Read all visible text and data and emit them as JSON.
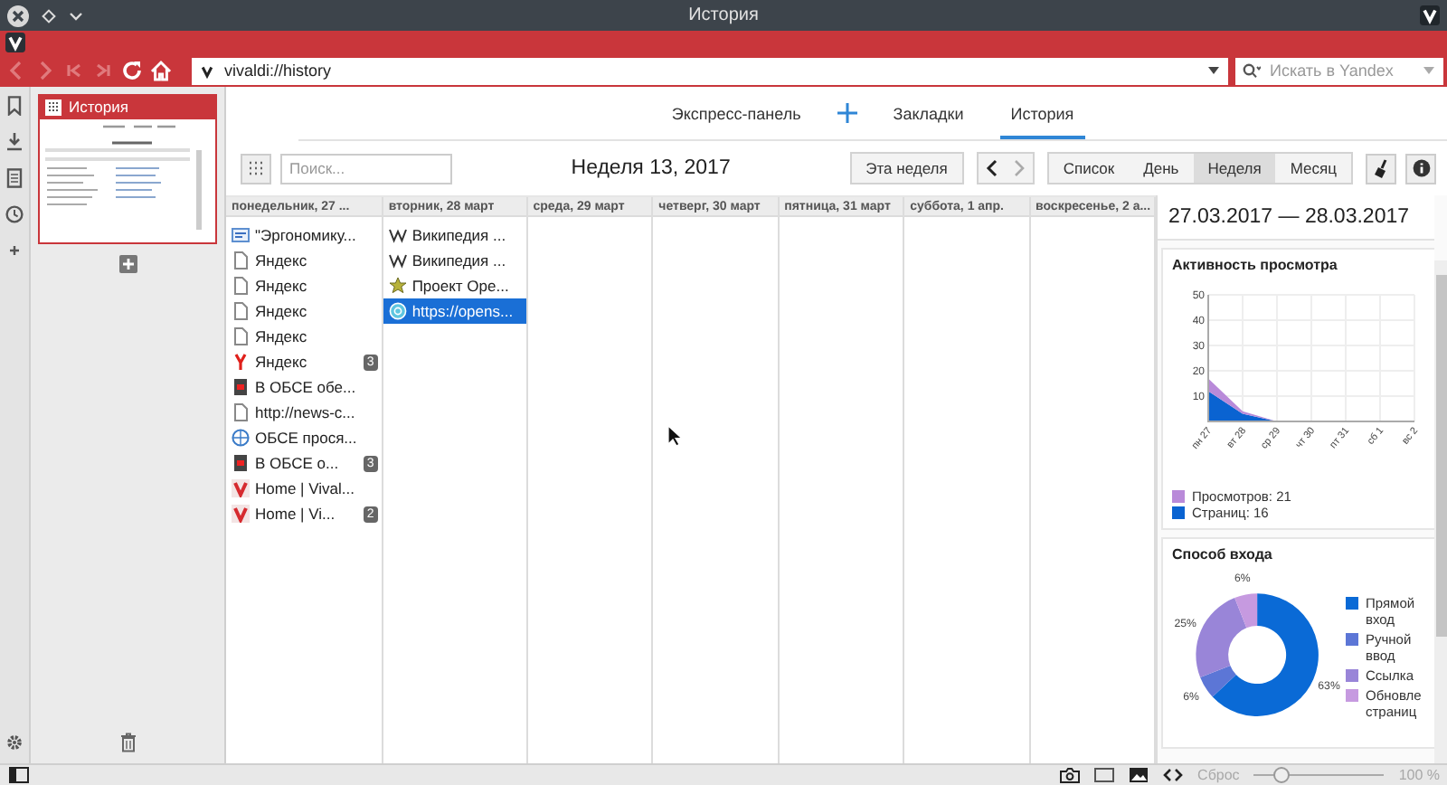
{
  "window": {
    "title": "История"
  },
  "address_bar": {
    "url": "vivaldi://history",
    "search_placeholder": "Искать в Yandex"
  },
  "panel": {
    "tab_title": "История"
  },
  "nav_tabs": [
    {
      "label": "Экспресс-панель",
      "selected": false
    },
    {
      "label": "Закладки",
      "selected": false
    },
    {
      "label": "История",
      "selected": true
    }
  ],
  "toolbar": {
    "search_placeholder": "Поиск...",
    "title": "Неделя 13, 2017",
    "this_week": "Эта неделя",
    "views": [
      {
        "label": "Список",
        "selected": false
      },
      {
        "label": "День",
        "selected": false
      },
      {
        "label": "Неделя",
        "selected": true
      },
      {
        "label": "Месяц",
        "selected": false
      }
    ]
  },
  "days": [
    {
      "header": "понедельник, 27 ...",
      "entries": [
        {
          "title": "\"Эргономику...",
          "kind": "rss",
          "selected": false
        },
        {
          "title": "Яндекс",
          "kind": "page",
          "selected": false
        },
        {
          "title": "Яндекс",
          "kind": "page",
          "selected": false
        },
        {
          "title": "Яндекс",
          "kind": "page",
          "selected": false
        },
        {
          "title": "Яндекс",
          "kind": "page",
          "selected": false
        },
        {
          "title": "Яндекс",
          "kind": "yandex",
          "count": "3",
          "selected": false
        },
        {
          "title": "В ОБСЕ обе...",
          "kind": "news",
          "selected": false
        },
        {
          "title": "http://news-c...",
          "kind": "page",
          "selected": false
        },
        {
          "title": "ОБСЕ прося...",
          "kind": "globe",
          "selected": false
        },
        {
          "title": "В ОБСЕ о...",
          "kind": "news",
          "count": "3",
          "selected": false
        },
        {
          "title": "Home | Vival...",
          "kind": "vivaldi",
          "selected": false
        },
        {
          "title": "Home | Vi...",
          "kind": "vivaldi",
          "count": "2",
          "selected": false
        }
      ]
    },
    {
      "header": "вторник, 28 март",
      "entries": [
        {
          "title": "Википедия ...",
          "kind": "wikipedia",
          "selected": false
        },
        {
          "title": "Википедия ...",
          "kind": "wikipedia",
          "selected": false
        },
        {
          "title": "Проект Ope...",
          "kind": "star",
          "selected": false
        },
        {
          "title": "https://opens...",
          "kind": "web",
          "selected": true
        }
      ]
    },
    {
      "header": "среда, 29 март"
    },
    {
      "header": "четверг, 30 март"
    },
    {
      "header": "пятница, 31 март"
    },
    {
      "header": "суббота, 1 апр."
    },
    {
      "header": "воскресенье, 2 а..."
    }
  ],
  "stats": {
    "range": "27.03.2017 — 28.03.2017",
    "activity": {
      "title": "Активность просмотра",
      "chart_data": {
        "type": "area",
        "stacked": true,
        "categories": [
          "пн 27",
          "вт 28",
          "ср 29",
          "чт 30",
          "пт 31",
          "сб 1",
          "вс 2"
        ],
        "series": [
          {
            "color": "#0a63d1",
            "values": [
              12,
              3,
              0,
              0,
              0,
              0,
              0
            ]
          },
          {
            "color": "#b98ad9",
            "values": [
              5,
              1,
              0,
              0,
              0,
              0,
              0
            ]
          }
        ],
        "ylim": [
          0,
          50
        ],
        "yticks": [
          10,
          20,
          30,
          40,
          50
        ],
        "grid": true
      },
      "legend": [
        {
          "label": "Просмотров: 21",
          "color": "#b98ad9"
        },
        {
          "label": "Страниц: 16",
          "color": "#0a63d1"
        }
      ]
    },
    "entry": {
      "title": "Способ входа",
      "chart_data": {
        "type": "donut",
        "values": [
          63,
          6,
          25,
          6
        ],
        "value_labels": [
          "63%",
          "6%",
          "25%",
          "6%"
        ]
      },
      "legend": [
        {
          "label": "Прямой вход",
          "color": "#0a6ad6"
        },
        {
          "label": "Ручной ввод",
          "color": "#5c76d6"
        },
        {
          "label": "Ссылка",
          "color": "#9985d8"
        },
        {
          "label": "Обновле страниц",
          "color": "#c69ae0"
        }
      ]
    }
  },
  "status_bar": {
    "reset": "Сброс",
    "zoom_text": "100 %",
    "zoom": {
      "level": 0.2
    }
  }
}
